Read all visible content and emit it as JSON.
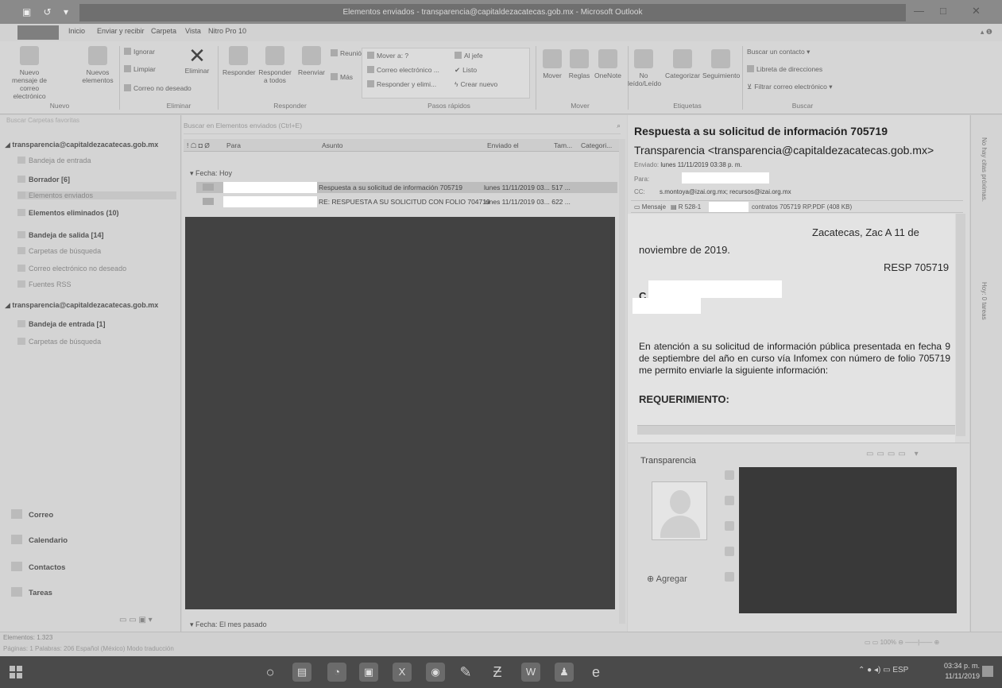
{
  "window": {
    "title": "Elementos enviados - transparencia@capitaldezacatecas.gob.mx - Microsoft Outlook",
    "qat": "▣ ↺ ▾",
    "controls": {
      "min": "—",
      "max": "□",
      "close": "✕"
    }
  },
  "tabs": [
    "Inicio",
    "Enviar y recibir",
    "Carpeta",
    "Vista",
    "Nitro Pro 10"
  ],
  "ribbon": {
    "nuevo": {
      "new_mail": "Nuevo mensaje de correo electrónico",
      "new_items": "Nuevos elementos",
      "group": "Nuevo"
    },
    "eliminar": {
      "ignorar": "Ignorar",
      "limpiar": "Limpiar",
      "correo_no_deseado": "Correo no deseado",
      "eliminar": "Eliminar",
      "group": "Eliminar"
    },
    "responder": {
      "responder": "Responder",
      "responder_todos": "Responder a todos",
      "reenviar": "Reenviar",
      "reunion": "Reunión",
      "mas": "Más",
      "group": "Responder"
    },
    "pasos": {
      "mover_a": "Mover a: ?",
      "correo_electronico": "Correo electrónico ...",
      "responder_eliminar": "Responder y elimi...",
      "al_jefe": "Al jefe",
      "listo": "Listo",
      "crear_nuevo": "Crear nuevo",
      "group": "Pasos rápidos"
    },
    "mover": {
      "mover": "Mover",
      "reglas": "Reglas",
      "onenote": "OneNote",
      "group": "Mover"
    },
    "etiquetas": {
      "no_leido": "No leído/Leído",
      "categorizar": "Categorizar",
      "seguimiento": "Seguimiento",
      "group": "Etiquetas"
    },
    "buscar": {
      "buscar_contacto": "Buscar un contacto",
      "libreta": "Libreta de direcciones",
      "filtrar": "Filtrar correo electrónico",
      "group": "Buscar"
    }
  },
  "folders": {
    "search_placeholder": "Buscar Carpetas favoritas",
    "account1": "transparencia@capitaldezacatecas.gob.mx",
    "items": [
      {
        "label": "Bandeja de entrada",
        "bold": false
      },
      {
        "label": "Borrador [6]",
        "bold": false
      },
      {
        "label": "Elementos enviados",
        "bold": false
      },
      {
        "label": "Elementos eliminados (10)",
        "bold": true
      },
      {
        "label": "Bandeja de salida [14]",
        "bold": true
      },
      {
        "label": "Carpetas de búsqueda",
        "bold": false
      },
      {
        "label": "Correo electrónico no deseado",
        "bold": false
      },
      {
        "label": "Fuentes RSS",
        "bold": false
      }
    ],
    "account2": "transparencia@capitaldezacatecas.gob.mx",
    "items2": [
      {
        "label": "Bandeja de entrada [1]",
        "bold": true
      },
      {
        "label": "Carpetas de búsqueda",
        "bold": false
      }
    ],
    "nav": [
      "Correo",
      "Calendario",
      "Contactos",
      "Tareas"
    ]
  },
  "list": {
    "search_placeholder": "Buscar en Elementos enviados (Ctrl+E)",
    "columns": {
      "icons": "! ☖ ◘ Ø",
      "para": "Para",
      "asunto": "Asunto",
      "enviado": "Enviado el",
      "tam": "Tam...",
      "categoria": "Categori..."
    },
    "group_today": "Fecha: Hoy",
    "rows": [
      {
        "subject": "Respuesta a su solicitud de información 705719",
        "date": "lunes 11/11/2019 03... 517 ..."
      },
      {
        "subject": "RE: RESPUESTA A SU SOLICITUD CON FOLIO 704719",
        "date": "lunes 11/11/2019 03... 622 ..."
      }
    ],
    "group_last_month": "Fecha: El mes pasado"
  },
  "reading": {
    "subject": "Respuesta a su solicitud de información 705719",
    "from": "Transparencia <transparencia@capitaldezacatecas.gob.mx>",
    "sent_label": "Enviado:",
    "sent_value": "lunes 11/11/2019 03:38 p. m.",
    "to_label": "Para:",
    "cc_label": "CC:",
    "cc_value": "s.montoya@izai.org.mx; recursos@izai.org.mx",
    "message_tab": "Mensaje",
    "attachment_prefix": "R 528-1",
    "attachment_suffix": "contratos 705719 RP.PDF (408 KB)",
    "body_place": "Zacatecas, Zac  A  11 de",
    "body_date_cont": "noviembre  de 2019.",
    "body_resp": "RESP 705719",
    "body_c": "C.",
    "body_para": "En atención a su solicitud de información pública presentada en fecha 9 de septiembre del año en curso vía Infomex con número de folio 705719 me permito enviarle la siguiente información:",
    "body_req": "REQUERIMIENTO:"
  },
  "people": {
    "name": "Transparencia",
    "add": "Agregar"
  },
  "todo": {
    "no_appts": "No hay citas próximas.",
    "today": "Hoy: 0 tareas"
  },
  "status": {
    "items": "Elementos: 1.323",
    "line2": "Páginas: 1   Palabras: 206   Español (México)   Modo traducción",
    "zoom": "100%"
  },
  "taskbar": {
    "lang": "ESP",
    "time": "03:34 p. m.",
    "date": "11/11/2019"
  }
}
